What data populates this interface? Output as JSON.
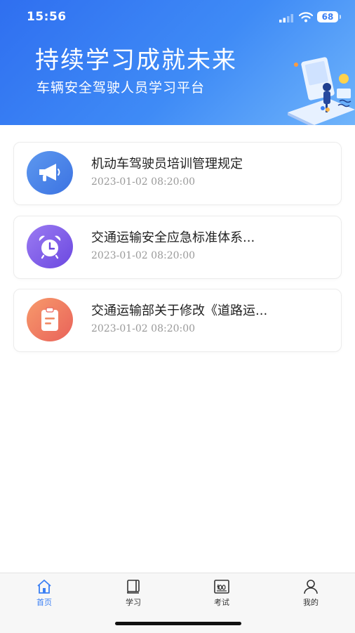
{
  "status": {
    "time": "15:56",
    "battery": "68"
  },
  "header": {
    "title": "持续学习成就未来",
    "subtitle": "车辆安全驾驶人员学习平台"
  },
  "items": [
    {
      "title": "机动车驾驶员培训管理规定",
      "date": "2023-01-02 08:20:00",
      "icon": "megaphone-icon"
    },
    {
      "title": "交通运输安全应急标准体系...",
      "date": "2023-01-02 08:20:00",
      "icon": "alarm-clock-icon"
    },
    {
      "title": "交通运输部关于修改《道路运...",
      "date": "2023-01-02 08:20:00",
      "icon": "clipboard-icon"
    }
  ],
  "tabs": [
    {
      "label": "首页",
      "icon": "home-icon",
      "active": true
    },
    {
      "label": "学习",
      "icon": "book-icon",
      "active": false
    },
    {
      "label": "考试",
      "icon": "exam-icon",
      "active": false
    },
    {
      "label": "我的",
      "icon": "user-icon",
      "active": false
    }
  ],
  "colors": {
    "primary": "#3a7ff4",
    "card_border": "#ececec",
    "date_text": "#999999"
  }
}
